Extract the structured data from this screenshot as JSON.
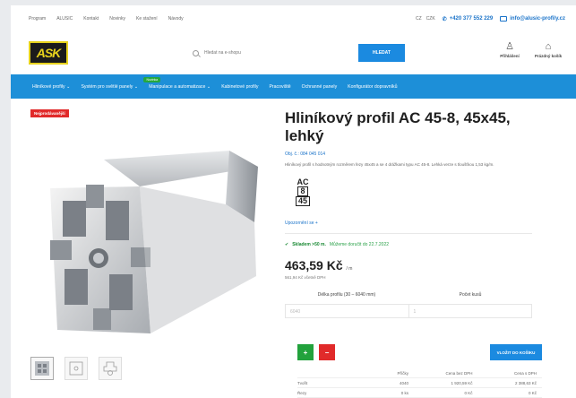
{
  "topbar": {
    "nav": [
      "Program",
      "ALUSIC",
      "Kontakt",
      "Novinky",
      "Ke stažení",
      "Návody"
    ],
    "language": "CZ",
    "currency": "CZK",
    "phone": "+420 377 552 229",
    "email": "info@alusic-profily.cz"
  },
  "header": {
    "logo_text": "ASK",
    "search_placeholder": "Hledat na e-shopu",
    "search_button": "HLEDAT",
    "login_label": "Přihlášení",
    "cart_label": "Prázdný košík"
  },
  "nav": {
    "items": [
      "Hliníkové profily",
      "Systém pro světlé panely",
      "Manipulace a automatizace",
      "Kabinetové profily",
      "Pracoviště",
      "Ochranné panely",
      "Konfigurátor dopravníků"
    ],
    "badge": "Novinka"
  },
  "product": {
    "sale_badge": "Nejprodávanější",
    "title": "Hliníkový profil AC 45-8, 45x45, lehký",
    "code": "Obj. č.: 084 045 014",
    "description": "Hliníkový profil s hodnotným rozměrem fezy 45x45 a se 4 drážkami typu AC 45-8. Lehká verze s tloušťkou 1,53 kg/m.",
    "profile_icon_text": [
      "AC",
      "8",
      "45"
    ],
    "more_info": "Upozornění se +",
    "stock_ok": "Skladem >50 m.",
    "stock_rest": "Můžeme doručit do 22.7.2022",
    "price": "463,59 Kč",
    "price_unit": "/ m",
    "vat_note": "561,94 Kč včetně DPH",
    "option_length_label": "Délka profilu (30 – 6040 mm)",
    "option_qty_label": "Počet kusů",
    "option_length_value": "6040",
    "option_qty_value": "1",
    "add_to_cart": "VLOŽIT DO KOŠÍKU"
  },
  "table": {
    "headers": [
      "",
      "Příčky",
      "Cena bez DPH",
      "Cena s DPH"
    ],
    "rows": [
      [
        "Tvořit",
        "4040",
        "1 920,59 Kč",
        "2 388,63 Kč"
      ],
      [
        "Řezy",
        "0 ks",
        "0 Kč",
        "0 Kč"
      ]
    ]
  }
}
